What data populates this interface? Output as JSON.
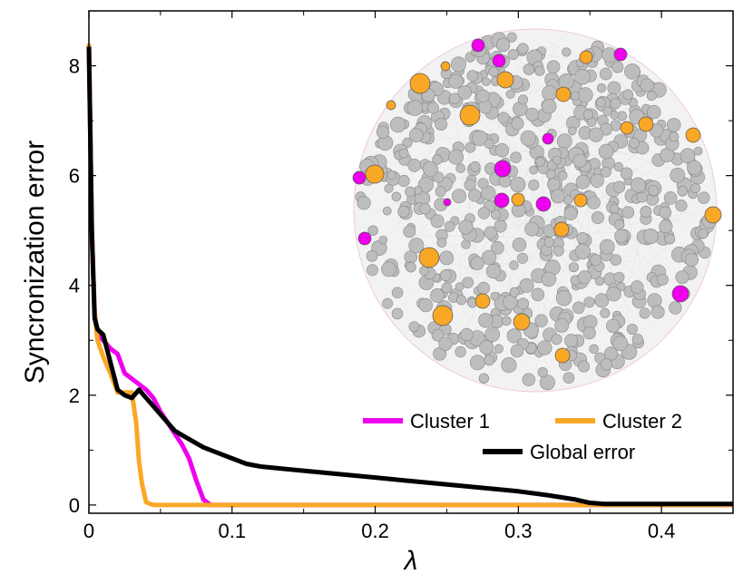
{
  "chart_data": {
    "type": "line",
    "xlabel": "λ",
    "ylabel": "Syncronization error",
    "xlim": [
      0,
      0.45
    ],
    "ylim": [
      -0.15,
      9.0
    ],
    "xticks": [
      "0",
      "0.1",
      "0.2",
      "0.3",
      "0.4"
    ],
    "xtick_values": [
      0,
      0.1,
      0.2,
      0.3,
      0.4
    ],
    "yticks": [
      "0",
      "2",
      "4",
      "6",
      "8"
    ],
    "ytick_values": [
      0,
      2,
      4,
      6,
      8
    ],
    "grid": false,
    "legend_position": "lower-right",
    "colors": {
      "cluster1": "#ee00ee",
      "cluster2": "#f9a825",
      "global": "#000000",
      "node_gray": "#bdbdbd"
    },
    "series": [
      {
        "name": "Cluster 1",
        "x": [
          0,
          0.002,
          0.004,
          0.006,
          0.01,
          0.015,
          0.02,
          0.025,
          0.03,
          0.04,
          0.045,
          0.05,
          0.055,
          0.06,
          0.065,
          0.07,
          0.075,
          0.08,
          0.085,
          0.1,
          0.2,
          0.3,
          0.45
        ],
        "y": [
          8.4,
          5.0,
          3.5,
          3.1,
          3.0,
          2.85,
          2.75,
          2.4,
          2.3,
          2.1,
          1.95,
          1.7,
          1.5,
          1.3,
          1.1,
          0.85,
          0.45,
          0.1,
          0.0,
          0.0,
          0.0,
          0.0,
          0.0
        ]
      },
      {
        "name": "Cluster 2",
        "x": [
          0,
          0.002,
          0.004,
          0.006,
          0.01,
          0.015,
          0.02,
          0.025,
          0.03,
          0.033,
          0.035,
          0.037,
          0.04,
          0.045,
          0.05,
          0.1,
          0.2,
          0.3,
          0.45
        ],
        "y": [
          8.4,
          5.0,
          3.5,
          3.0,
          2.7,
          2.4,
          2.05,
          2.05,
          2.05,
          1.5,
          0.8,
          0.4,
          0.05,
          0.0,
          0.0,
          0.0,
          0.0,
          0.0,
          0.0
        ]
      },
      {
        "name": "Global error",
        "x": [
          0,
          0.002,
          0.004,
          0.006,
          0.01,
          0.015,
          0.02,
          0.025,
          0.03,
          0.035,
          0.04,
          0.045,
          0.05,
          0.055,
          0.06,
          0.07,
          0.08,
          0.09,
          0.1,
          0.11,
          0.12,
          0.14,
          0.16,
          0.18,
          0.2,
          0.22,
          0.24,
          0.26,
          0.28,
          0.3,
          0.32,
          0.34,
          0.35,
          0.36,
          0.4,
          0.45
        ],
        "y": [
          8.35,
          5.0,
          3.4,
          3.2,
          3.1,
          2.6,
          2.1,
          2.0,
          1.95,
          2.1,
          1.95,
          1.8,
          1.65,
          1.5,
          1.35,
          1.2,
          1.05,
          0.95,
          0.85,
          0.75,
          0.7,
          0.65,
          0.6,
          0.55,
          0.5,
          0.45,
          0.4,
          0.35,
          0.3,
          0.25,
          0.18,
          0.1,
          0.04,
          0.02,
          0.02,
          0.02
        ]
      }
    ],
    "inset_network": {
      "description_visible": false,
      "node_groups": [
        {
          "group": "Cluster 1",
          "color": "#ee00ee"
        },
        {
          "group": "Cluster 2",
          "color": "#f9a825"
        },
        {
          "group": "other",
          "color": "#bdbdbd"
        }
      ]
    }
  }
}
